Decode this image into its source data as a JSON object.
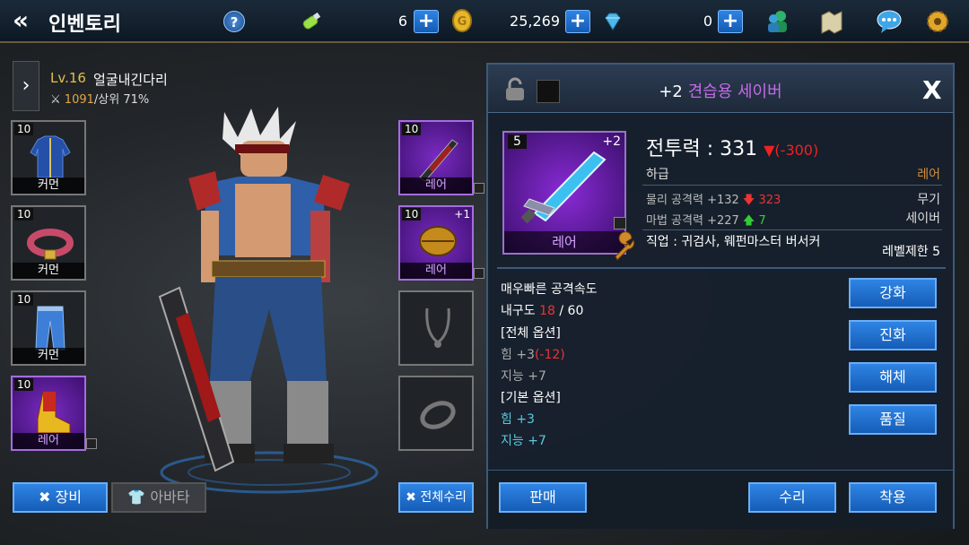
{
  "header": {
    "title": "인벤토리",
    "help_label": "?",
    "resources": [
      {
        "name": "stamina",
        "value": "6",
        "icon": "potion-icon"
      },
      {
        "name": "gold",
        "value": "25,269",
        "icon": "gold-coin-icon"
      },
      {
        "name": "gem",
        "value": "0",
        "icon": "diamond-icon"
      }
    ],
    "plus_label": "+",
    "icons": [
      "friends-icon",
      "map-icon",
      "chat-icon",
      "settings-gear-icon"
    ]
  },
  "character": {
    "expand_label": "›",
    "level": "Lv.16",
    "name": "얼굴내긴다리",
    "power": "1091",
    "rank": "/상위 71%"
  },
  "left_slots": [
    {
      "level": "10",
      "caption": "커먼",
      "icon": "jacket-icon"
    },
    {
      "level": "10",
      "caption": "커먼",
      "icon": "belt-icon"
    },
    {
      "level": "10",
      "caption": "커먼",
      "icon": "pants-icon"
    },
    {
      "level": "10",
      "caption": "레어",
      "icon": "boots-icon"
    }
  ],
  "right_slots": [
    {
      "level": "10",
      "caption": "레어",
      "icon": "sword-icon",
      "plus": ""
    },
    {
      "level": "10",
      "caption": "레어",
      "icon": "helmet-icon",
      "plus": "+1"
    },
    {
      "level": "",
      "caption": "",
      "icon": "necklace-icon",
      "plus": ""
    },
    {
      "level": "",
      "caption": "",
      "icon": "ring-icon",
      "plus": ""
    }
  ],
  "bottom_buttons": {
    "equip": "장비",
    "avatar": "아바타",
    "repair_all": "전체수리"
  },
  "item": {
    "enhance": "+2",
    "name": "견습용 세이버",
    "close": "X",
    "icon_level": "5",
    "icon_plus": "+2",
    "icon_caption": "레어",
    "power_label": "전투력 : 331",
    "power_diff": "▼(-300)",
    "grade": "하급",
    "rarity": "레어",
    "phys_attack": "물리 공격력 +132",
    "phys_cmp": "323",
    "mag_attack": "마법 공격력 +227",
    "mag_cmp": "7",
    "type": "무기",
    "subtype": "세이버",
    "job": "직업 : 귀검사, 웨펀마스터 버서커",
    "level_limit": "레벨제한 5",
    "speed_text": "매우빠른 공격속도",
    "durability_label": "내구도 ",
    "durability_cur": "18",
    "durability_max": " / 60",
    "all_options_title": "[전체 옵션]",
    "str_all": "힘 +3",
    "str_all_diff": "(-12)",
    "int_all": "지능 +7",
    "base_options_title": "[기본 옵션]",
    "str_base": "힘 +3",
    "int_base": "지능 +7"
  },
  "actions": {
    "enhance": "강화",
    "evolve": "진화",
    "dismantle": "해체",
    "quality": "품질",
    "sell": "판매",
    "repair": "수리",
    "equip": "착용"
  }
}
